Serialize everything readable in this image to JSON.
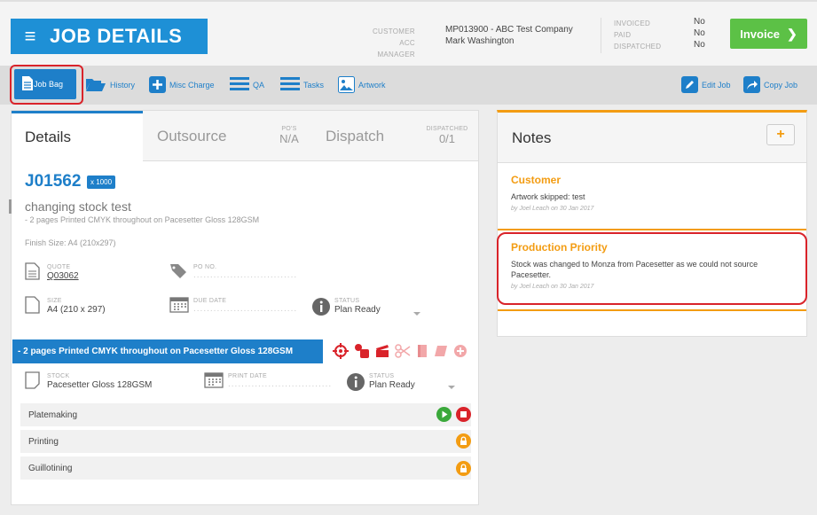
{
  "header": {
    "title": "JOB DETAILS",
    "customer_label": "CUSTOMER",
    "acc_manager_label": "ACC MANAGER",
    "customer_value": "MP013900 - ABC Test Company",
    "acc_manager_value": "Mark Washington",
    "invoiced_label": "INVOICED",
    "paid_label": "PAID",
    "dispatched_label": "DISPATCHED",
    "invoiced_value": "No",
    "paid_value": "No",
    "dispatched_value": "No",
    "invoice_button": "Invoice"
  },
  "toolbar": {
    "job_bag": "Job Bag",
    "history": "History",
    "misc_charge": "Misc Charge",
    "qa": "QA",
    "tasks": "Tasks",
    "artwork": "Artwork",
    "edit_job": "Edit Job",
    "copy_job": "Copy Job"
  },
  "tabs": {
    "details": "Details",
    "outsource": "Outsource",
    "pos_label": "PO'S",
    "pos_value": "N/A",
    "dispatch": "Dispatch",
    "dispatched_label": "DISPATCHED",
    "dispatched_value": "0/1"
  },
  "job": {
    "number": "J01562",
    "quantity": "x 1000",
    "title": "changing stock test",
    "subtitle": "- 2 pages Printed CMYK throughout on Pacesetter Gloss 128GSM",
    "finish_size": "Finish Size: A4 (210x297)",
    "quote_label": "QUOTE",
    "quote_value": "Q03062",
    "po_label": "PO NO.",
    "size_label": "SIZE",
    "size_value": "A4 (210 x 297)",
    "due_label": "DUE DATE",
    "status_label": "STATUS",
    "status_value": "Plan Ready"
  },
  "item": {
    "bar_title": "- 2 pages Printed CMYK throughout on Pacesetter Gloss 128GSM",
    "stock_label": "STOCK",
    "stock_value": "Pacesetter Gloss 128GSM",
    "print_date_label": "PRINT DATE",
    "status_label": "STATUS",
    "status_value": "Plan Ready",
    "steps": [
      "Platemaking",
      "Printing",
      "Guillotining"
    ]
  },
  "notes": {
    "title": "Notes",
    "add": "+",
    "items": [
      {
        "title": "Customer",
        "body": "Artwork skipped: test",
        "meta": "by Joel Leach on 30 Jan 2017"
      },
      {
        "title": "Production Priority",
        "body": "Stock was changed to Monza from Pacesetter as we could not source Pacesetter.",
        "meta": "by Joel Leach on 30 Jan 2017"
      }
    ]
  },
  "colors": {
    "primary": "#1e7fc9",
    "title_bg": "#1e90d6",
    "invoice": "#5cc146",
    "notes_accent": "#f39c12",
    "highlight": "#d9232a"
  }
}
